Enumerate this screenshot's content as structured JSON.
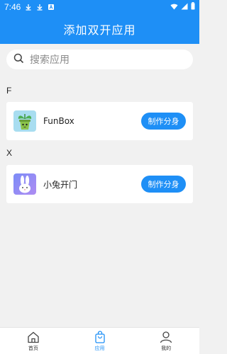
{
  "status_bar": {
    "time": "7:46",
    "icons": [
      "download-icon",
      "download-icon",
      "notification-a-icon",
      "wifi-icon",
      "signal-icon",
      "battery-icon"
    ]
  },
  "header": {
    "title": "添加双开应用"
  },
  "search": {
    "placeholder": "搜索应用"
  },
  "sections": [
    {
      "letter": "F",
      "apps": [
        {
          "name": "FunBox",
          "button": "制作分身",
          "icon": "plant-pot-icon"
        }
      ]
    },
    {
      "letter": "X",
      "apps": [
        {
          "name": "小兔开门",
          "button": "制作分身",
          "icon": "rabbit-icon"
        }
      ]
    }
  ],
  "bottom_nav": [
    {
      "label": "首页",
      "icon": "home-icon",
      "active": false
    },
    {
      "label": "应用",
      "icon": "shopping-bag-icon",
      "active": true
    },
    {
      "label": "我的",
      "icon": "user-icon",
      "active": false
    }
  ],
  "colors": {
    "primary": "#1e8ff6",
    "background": "#f1f1f1"
  }
}
